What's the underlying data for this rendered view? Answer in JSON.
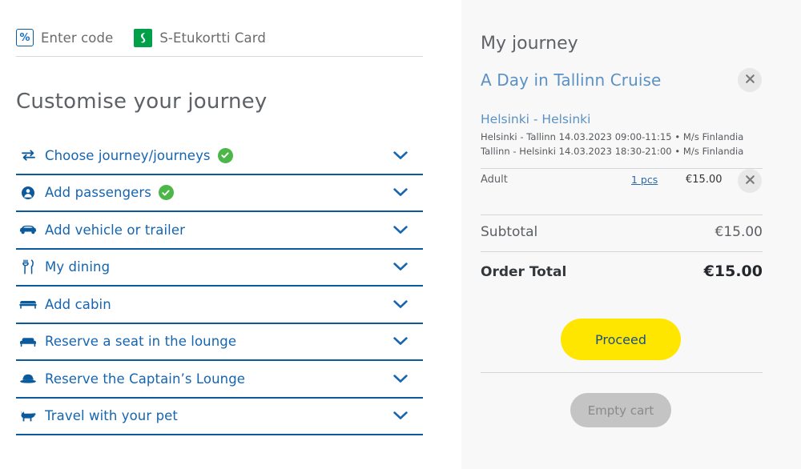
{
  "promo": {
    "items": [
      {
        "icon": "percent-icon",
        "label": "Enter code"
      },
      {
        "icon": "s-etukortti-icon",
        "label": "S-Etukortti Card"
      }
    ]
  },
  "left": {
    "title": "Customise your journey",
    "accordion": [
      {
        "icon": "swap-arrows-icon",
        "label": "Choose journey/journeys",
        "completed": true
      },
      {
        "icon": "passenger-icon",
        "label": "Add passengers",
        "completed": true
      },
      {
        "icon": "car-icon",
        "label": "Add vehicle or trailer",
        "completed": false
      },
      {
        "icon": "cutlery-icon",
        "label": "My dining",
        "completed": false
      },
      {
        "icon": "bed-icon",
        "label": "Add cabin",
        "completed": false
      },
      {
        "icon": "sofa-icon",
        "label": "Reserve a seat in the lounge",
        "completed": false
      },
      {
        "icon": "captains-hat-icon",
        "label": "Reserve the Captain’s Lounge",
        "completed": false
      },
      {
        "icon": "dog-icon",
        "label": "Travel with your pet",
        "completed": false
      }
    ]
  },
  "cart": {
    "title": "My journey",
    "subtitle": "A Day in Tallinn Cruise",
    "close_icon": "close-icon",
    "route": "Helsinki - Helsinki",
    "legs": [
      "Helsinki - Tallinn 14.03.2023 09:00-11:15 • M/s Finlandia",
      "Tallinn - Helsinki 14.03.2023 18:30-21:00 • M/s Finlandia"
    ],
    "passenger": {
      "label": "Adult",
      "quantity": "1 pcs",
      "price": "€15.00",
      "remove_icon": "close-icon"
    },
    "subtotal_label": "Subtotal",
    "subtotal_value": "€15.00",
    "order_total_label": "Order Total",
    "order_total_value": "€15.00",
    "proceed_label": "Proceed",
    "empty_cart_label": "Empty cart"
  },
  "colors": {
    "brand_blue": "#0a5a9c",
    "link_blue": "#1565b0",
    "accent_yellow": "#ffe600",
    "success_green": "#4cb648",
    "sok_green": "#00a049",
    "panel_bg": "#f8f8f8",
    "disabled_gray": "#c4c4c4"
  }
}
